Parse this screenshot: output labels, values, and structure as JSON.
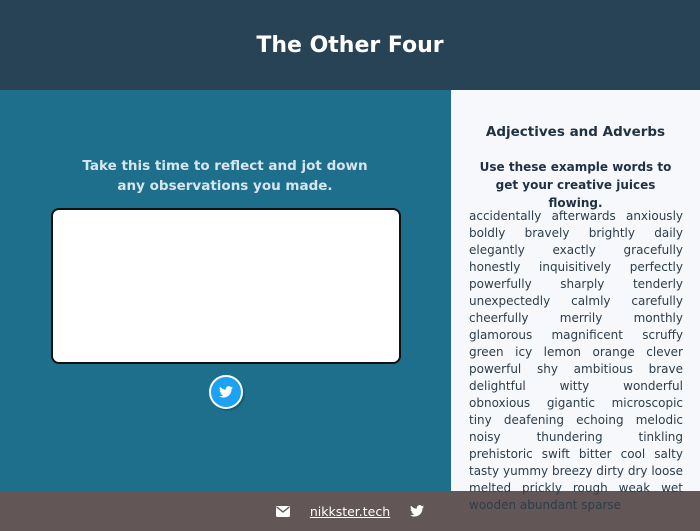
{
  "header": {
    "title": "The Other Four"
  },
  "left": {
    "prompt": "Take this time to reflect and jot down any observations you made.",
    "notes_value": "",
    "tweet_icon": "twitter-icon"
  },
  "right": {
    "heading": "Adjectives and Adverbs",
    "subheading": "Use these example words to get your creative juices flowing.",
    "words": "accidentally afterwards anxiously boldly bravely brightly daily elegantly exactly gracefully honestly inquisitively perfectly powerfully sharply tenderly unexpectedly calmly carefully cheerfully merrily monthly glamorous magnificent scruffy green icy lemon orange clever powerful shy ambitious brave delightful witty wonderful obnoxious gigantic microscopic tiny deafening echoing melodic noisy thundering tinkling prehistoric swift bitter cool salty tasty yummy breezy dirty dry loose melted prickly rough weak wet wooden abundant sparse"
  },
  "footer": {
    "link_text": "nikkster.tech",
    "icons": [
      "mail-icon",
      "twitter-icon"
    ]
  },
  "colors": {
    "header_bg": "#284356",
    "left_bg": "#1e6f8c",
    "right_bg": "#f7f8fb",
    "footer_bg": "#625656",
    "twitter": "#1da1f2"
  }
}
